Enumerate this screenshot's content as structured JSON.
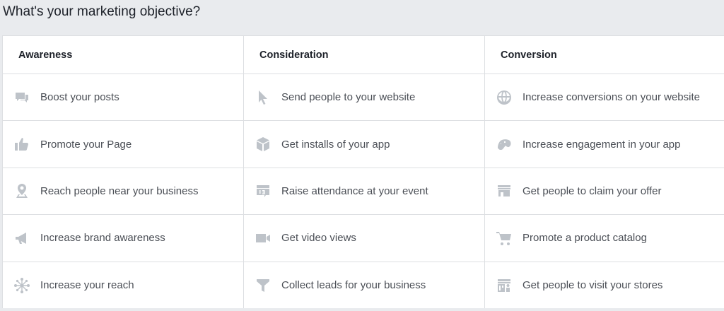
{
  "title": "What's your marketing objective?",
  "columns": [
    {
      "heading": "Awareness",
      "items": [
        {
          "label": "Boost your posts",
          "icon": "chat-bubbles-icon"
        },
        {
          "label": "Promote your Page",
          "icon": "thumbs-up-icon"
        },
        {
          "label": "Reach people near your business",
          "icon": "map-pin-icon"
        },
        {
          "label": "Increase brand awareness",
          "icon": "megaphone-icon"
        },
        {
          "label": "Increase your reach",
          "icon": "network-burst-icon"
        }
      ]
    },
    {
      "heading": "Consideration",
      "items": [
        {
          "label": "Send people to your website",
          "icon": "cursor-icon"
        },
        {
          "label": "Get installs of your app",
          "icon": "box-icon"
        },
        {
          "label": "Raise attendance at your event",
          "icon": "calendar-icon"
        },
        {
          "label": "Get video views",
          "icon": "video-camera-icon"
        },
        {
          "label": "Collect leads for your business",
          "icon": "funnel-icon"
        }
      ]
    },
    {
      "heading": "Conversion",
      "items": [
        {
          "label": "Increase conversions on your website",
          "icon": "globe-icon"
        },
        {
          "label": "Increase engagement in your app",
          "icon": "game-controller-icon"
        },
        {
          "label": "Get people to claim your offer",
          "icon": "storefront-icon"
        },
        {
          "label": "Promote a product catalog",
          "icon": "shopping-cart-icon"
        },
        {
          "label": "Get people to visit your stores",
          "icon": "store-visit-icon"
        }
      ]
    }
  ],
  "colors": {
    "icon": "#bec3c9",
    "text": "#4b4f56",
    "heading": "#1d2129",
    "background": "#e9ebee"
  }
}
